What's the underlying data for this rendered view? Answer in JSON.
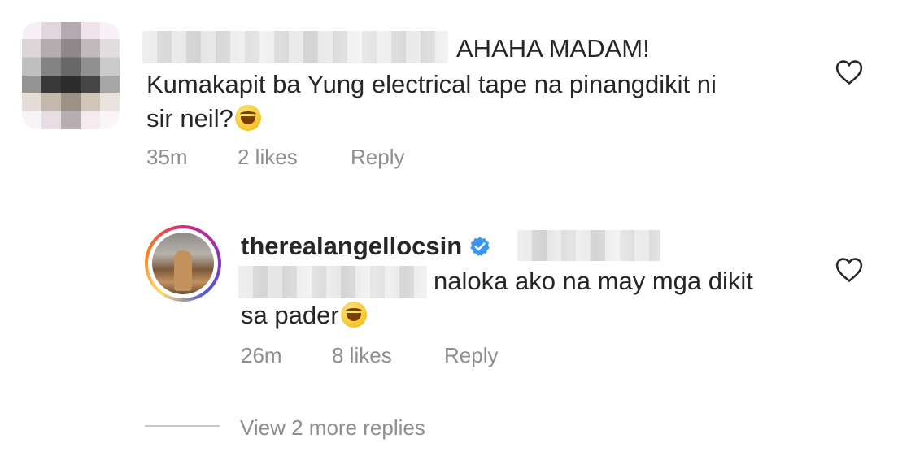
{
  "comment1": {
    "username_hidden": true,
    "mention_text": "AHAHA MADAM!",
    "body_line1": "Kumakapit ba Yung electrical tape na pinangdikit ni",
    "body_line2": "sir neil?",
    "time": "35m",
    "likes": "2 likes",
    "reply_label": "Reply",
    "icon": "heart-outline-icon"
  },
  "reply1": {
    "username": "therealangellocsin",
    "verified_icon": "verified-badge-icon",
    "body_line1": "naloka ako na may mga dikit",
    "body_line2": "sa pader",
    "time": "26m",
    "likes": "8 likes",
    "reply_label": "Reply",
    "icon": "heart-outline-icon"
  },
  "view_more": "View 2 more replies",
  "colors": {
    "text": "#262626",
    "muted": "#8e8e8e",
    "verified": "#3897f0"
  }
}
